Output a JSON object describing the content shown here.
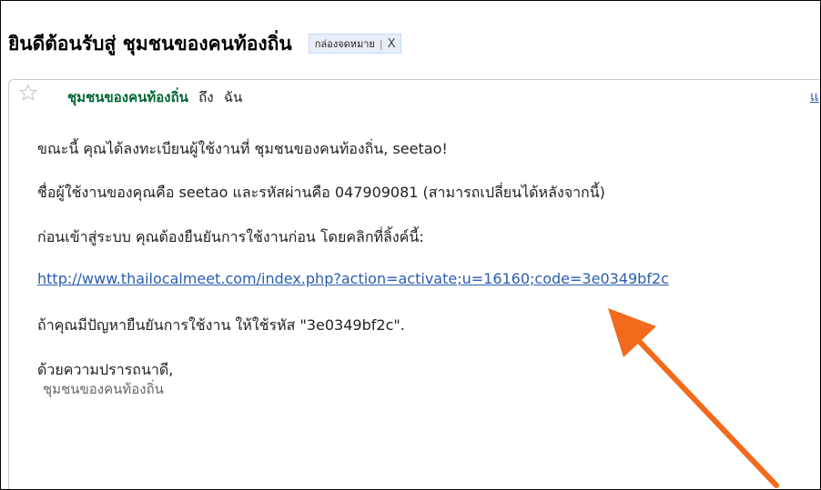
{
  "subject": "ยินดีต้อนรับสู่ ชุมชนของคนท้องถิ่น",
  "label": {
    "name": "กล่องจดหมาย",
    "remove_glyph": "X"
  },
  "message": {
    "star_icon": "star-icon",
    "sender": "ชุมชนของคนท้องถิ่น",
    "to_word": "ถึง",
    "recipient": "ฉัน",
    "header_link": "แ",
    "body": {
      "line1": "ขณะนี้ คุณได้ลงทะเบียนผู้ใช้งานที่ ชุมชนของคนท้องถิ่น, seetao!",
      "line2": "ชื่อผู้ใช้งานของคุณคือ seetao และรหัสผ่านคือ 047909081 (สามารถเปลี่ยนได้หลังจากนี้)",
      "line3": "ก่อนเข้าสู่ระบบ คุณต้องยืนยันการใช้งานก่อน โดยคลิกที่ลิ้งค์นี้:",
      "activation_link": "http://www.thailocalmeet.com/index.php?action=activate;u=16160;code=3e0349bf2c",
      "line5": "ถ้าคุณมีปัญหายืนยันการใช้งาน ให้ใช้รหัส \"3e0349bf2c\".",
      "closing": "ด้วยความปรารถนาดี,",
      "signature": "ชุมชนของคนท้องถิ่น"
    }
  },
  "annotation": {
    "arrow_color": "#f26a1b",
    "arrow_icon": "arrow-annotation"
  },
  "colors": {
    "sender_green": "#006633",
    "link_blue": "#2a5db0",
    "label_bg": "#e8eef7"
  }
}
